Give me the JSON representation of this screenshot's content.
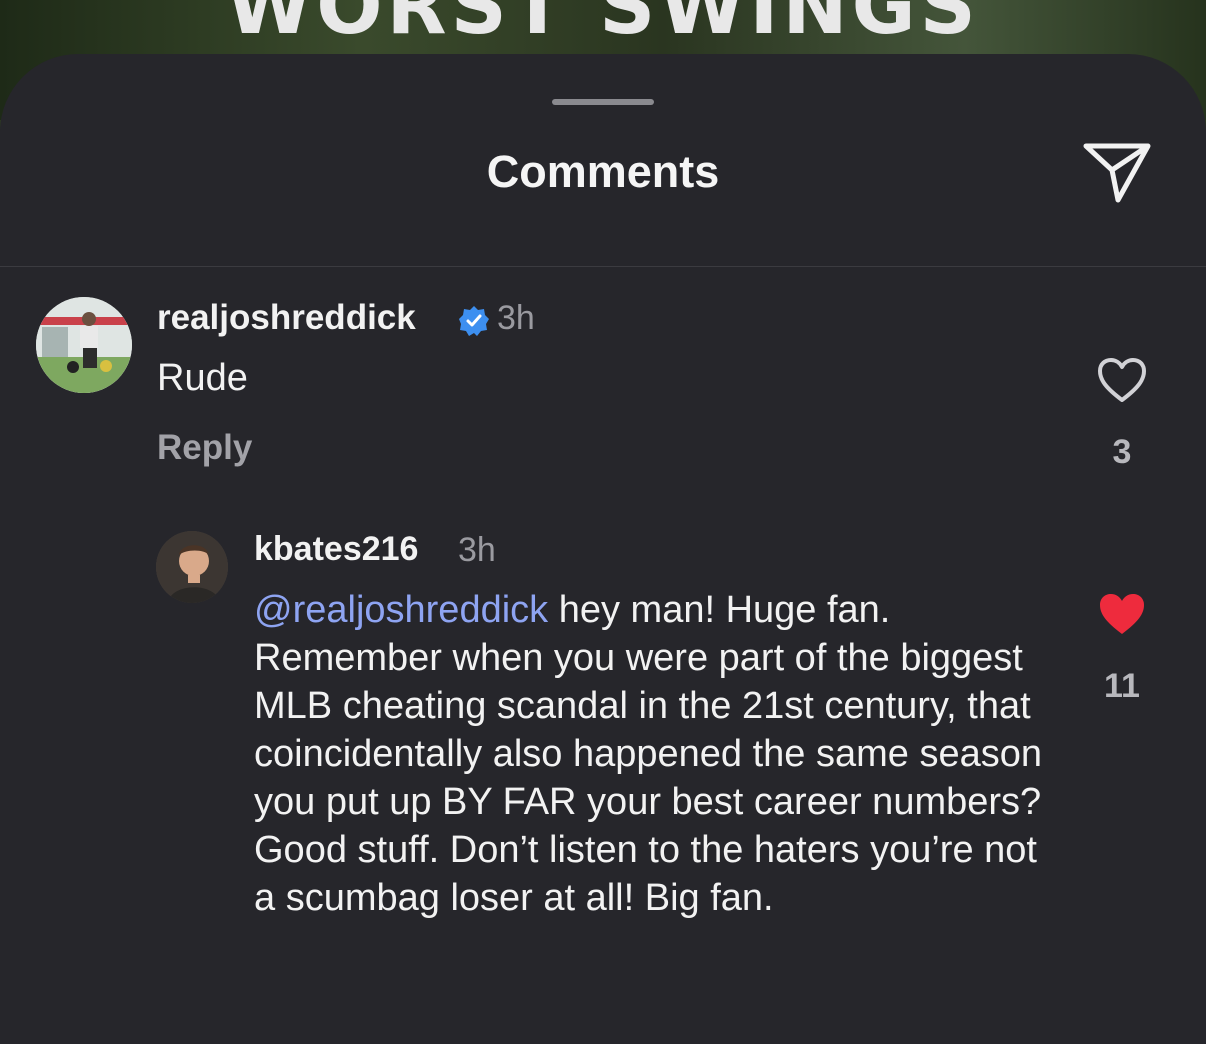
{
  "background": {
    "video_title_fragment": "WORST SWINGS"
  },
  "sheet": {
    "title": "Comments",
    "share_icon": "paper-plane-icon"
  },
  "comments": [
    {
      "username": "realjoshreddick",
      "verified": true,
      "time": "3h",
      "text": "Rude",
      "reply_label": "Reply",
      "likes": "3",
      "liked": false
    },
    {
      "username": "kbates216",
      "verified": false,
      "time": "3h",
      "mention": "@realjoshreddick",
      "text": " hey man! Huge fan. Remember when you were part of the biggest MLB cheating scandal in the 21st century, that coincidentally also happened the same season you put up BY FAR your best career numbers? Good stuff. Don’t listen to the haters you’re not a scumbag loser at all! Big fan.",
      "likes": "11",
      "liked": true
    }
  ],
  "colors": {
    "sheet_bg": "#26262b",
    "mention": "#8ea4f2",
    "verified_badge": "#3d8ff0",
    "liked_heart": "#ee2b3d"
  }
}
